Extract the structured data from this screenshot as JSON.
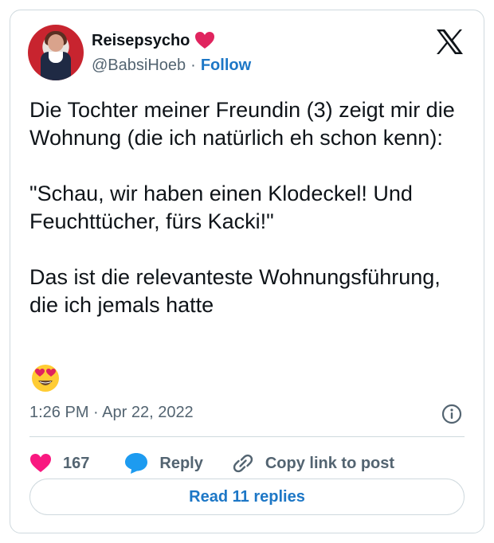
{
  "author": {
    "name": "Reisepsycho",
    "handle": "@BabsiHoeb",
    "separator": "·",
    "follow_label": "Follow"
  },
  "tweet": {
    "text": "Die Tochter meiner Freundin (3) zeigt mir die Wohnung (die ich natürlich eh schon kenn):\n\n\"Schau, wir haben einen Klodeckel! Und Feuchttücher, fürs Kacki!\"\n\nDas ist die relevanteste Wohnungsführung, die ich jemals hatte",
    "emoji": "smiling-face-with-heart-eyes",
    "timestamp": "1:26 PM · Apr 22, 2022"
  },
  "actions": {
    "like_count": "167",
    "reply_label": "Reply",
    "copy_link_label": "Copy link to post"
  },
  "read_replies_label": "Read 11 replies",
  "colors": {
    "accent": "#1d77c6",
    "like": "#f91880",
    "reply_icon": "#1d9bf0",
    "text": "#0f1419",
    "muted": "#536471",
    "border": "#cfd9de"
  },
  "icons": [
    "heart-emoji-icon",
    "x-logo-icon",
    "info-icon",
    "heart-icon",
    "reply-bubble-icon",
    "link-icon"
  ]
}
